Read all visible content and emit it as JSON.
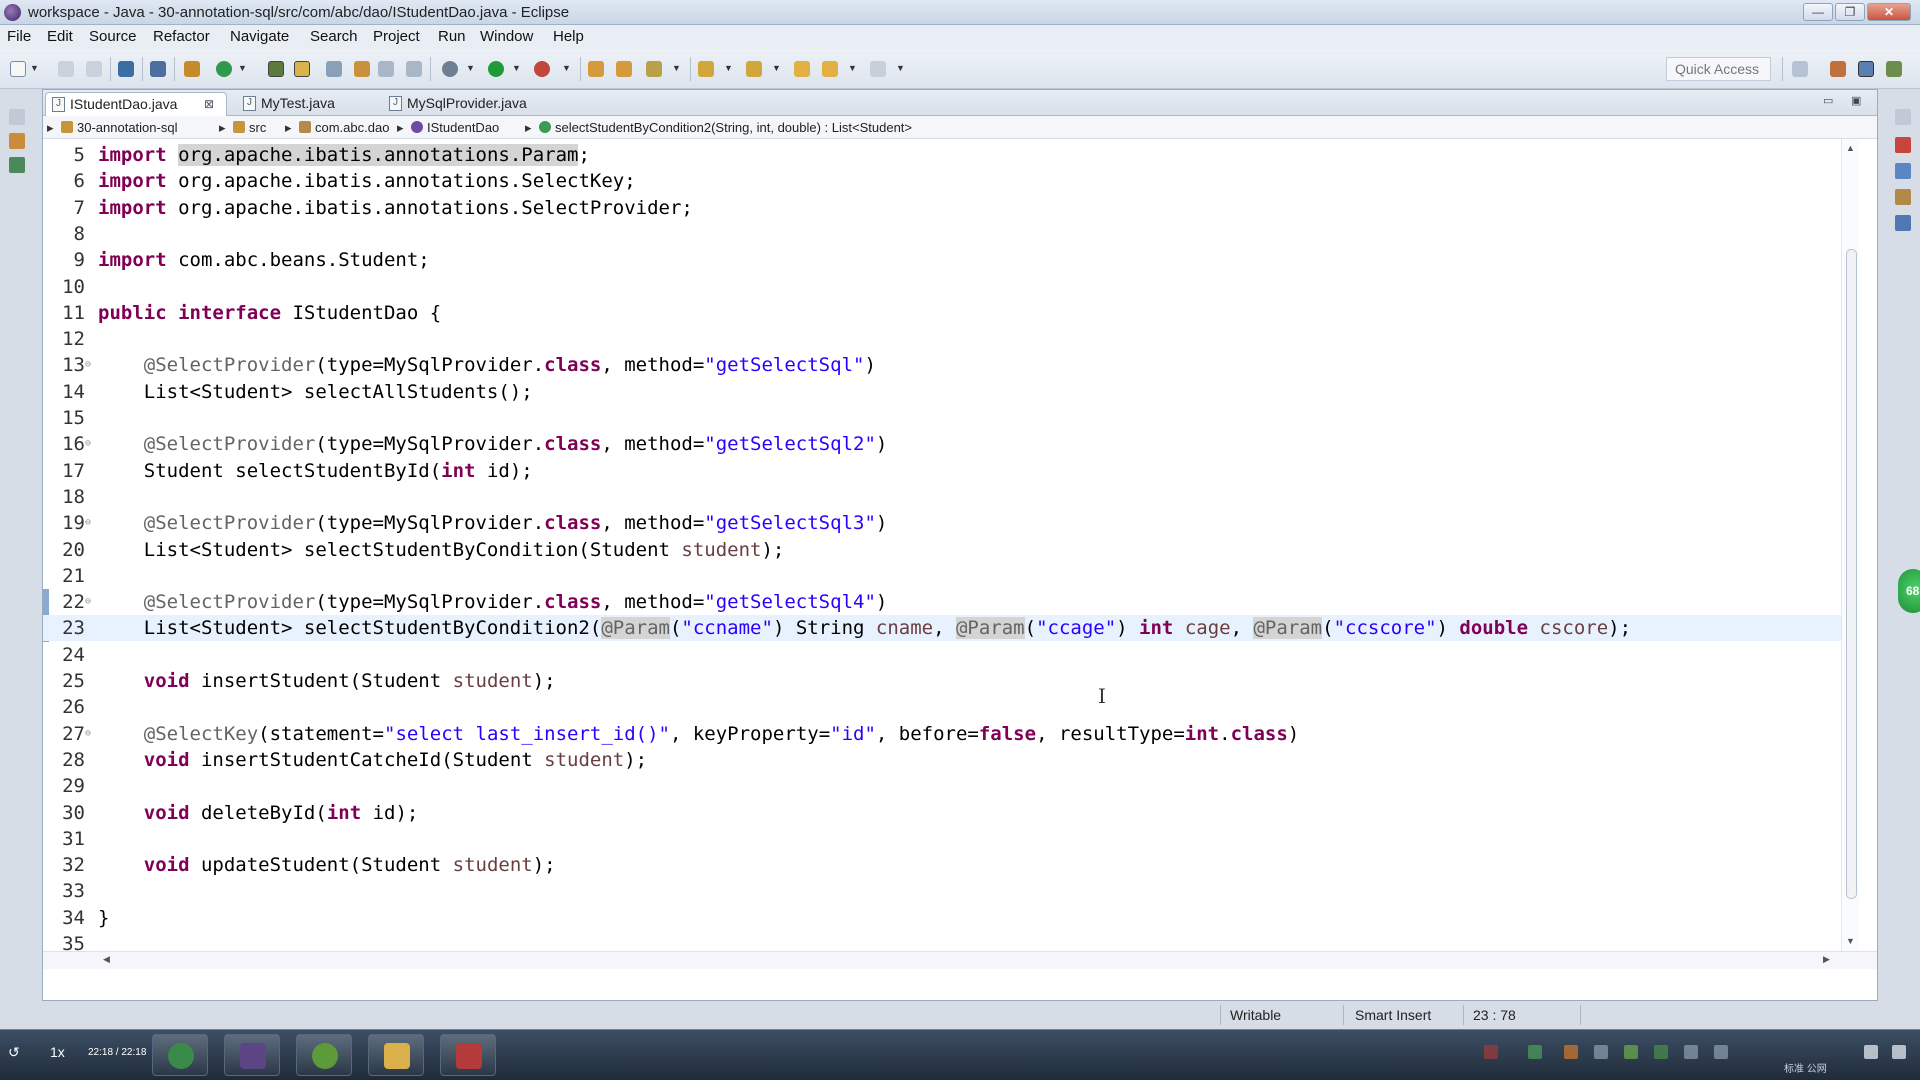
{
  "window": {
    "title": "workspace - Java - 30-annotation-sql/src/com/abc/dao/IStudentDao.java - Eclipse",
    "minimize_symbol": "—",
    "maximize_symbol": "❐",
    "close_symbol": "✕"
  },
  "menu": [
    "File",
    "Edit",
    "Source",
    "Refactor",
    "Navigate",
    "Search",
    "Project",
    "Run",
    "Window",
    "Help"
  ],
  "toolbar": {
    "quick_access_placeholder": "Quick Access"
  },
  "tabs": [
    {
      "label": "IStudentDao.java",
      "active": true,
      "close": "⊠"
    },
    {
      "label": "MyTest.java",
      "active": false
    },
    {
      "label": "MySqlProvider.java",
      "active": false
    }
  ],
  "tab_controls": {
    "minimize": "▭",
    "maximize": "▣"
  },
  "breadcrumb": [
    "30-annotation-sql",
    "src",
    "com.abc.dao",
    "IStudentDao",
    "selectStudentByCondition2(String, int, double) : List<Student>"
  ],
  "code": {
    "current_line": 23,
    "lines": [
      {
        "n": "5",
        "parts": [
          [
            "kw",
            "import"
          ],
          [
            "",
            " "
          ],
          [
            "hl",
            "org.apache.ibatis.annotations.Param"
          ],
          [
            "",
            ";"
          ]
        ]
      },
      {
        "n": "6",
        "parts": [
          [
            "kw",
            "import"
          ],
          [
            "",
            " org.apache.ibatis.annotations.SelectKey;"
          ]
        ]
      },
      {
        "n": "7",
        "parts": [
          [
            "kw",
            "import"
          ],
          [
            "",
            " org.apache.ibatis.annotations.SelectProvider;"
          ]
        ]
      },
      {
        "n": "8",
        "parts": []
      },
      {
        "n": "9",
        "parts": [
          [
            "kw",
            "import"
          ],
          [
            "",
            " com.abc.beans.Student;"
          ]
        ]
      },
      {
        "n": "10",
        "parts": []
      },
      {
        "n": "11",
        "parts": [
          [
            "kw",
            "public"
          ],
          [
            "",
            " "
          ],
          [
            "kw",
            "interface"
          ],
          [
            "",
            " IStudentDao {"
          ]
        ]
      },
      {
        "n": "12",
        "parts": []
      },
      {
        "n": "13",
        "fold": "⊖",
        "parts": [
          [
            "",
            "    "
          ],
          [
            "ann",
            "@SelectProvider"
          ],
          [
            "",
            "(type=MySqlProvider."
          ],
          [
            "kw",
            "class"
          ],
          [
            "",
            ", method="
          ],
          [
            "str",
            "\"getSelectSql\""
          ],
          [
            "",
            ")"
          ]
        ]
      },
      {
        "n": "14",
        "parts": [
          [
            "",
            "    List<Student> selectAllStudents();"
          ]
        ]
      },
      {
        "n": "15",
        "parts": []
      },
      {
        "n": "16",
        "fold": "⊖",
        "parts": [
          [
            "",
            "    "
          ],
          [
            "ann",
            "@SelectProvider"
          ],
          [
            "",
            "(type=MySqlProvider."
          ],
          [
            "kw",
            "class"
          ],
          [
            "",
            ", method="
          ],
          [
            "str",
            "\"getSelectSql2\""
          ],
          [
            "",
            ")"
          ]
        ]
      },
      {
        "n": "17",
        "parts": [
          [
            "",
            "    Student selectStudentById("
          ],
          [
            "kw",
            "int"
          ],
          [
            "",
            " id);"
          ]
        ]
      },
      {
        "n": "18",
        "parts": []
      },
      {
        "n": "19",
        "fold": "⊖",
        "parts": [
          [
            "",
            "    "
          ],
          [
            "ann",
            "@SelectProvider"
          ],
          [
            "",
            "(type=MySqlProvider."
          ],
          [
            "kw",
            "class"
          ],
          [
            "",
            ", method="
          ],
          [
            "str",
            "\"getSelectSql3\""
          ],
          [
            "",
            ")"
          ]
        ]
      },
      {
        "n": "20",
        "parts": [
          [
            "",
            "    List<Student> selectStudentByCondition(Student "
          ],
          [
            "param",
            "student"
          ],
          [
            "",
            ");"
          ]
        ]
      },
      {
        "n": "21",
        "parts": []
      },
      {
        "n": "22",
        "fold": "⊖",
        "parts": [
          [
            "",
            "    "
          ],
          [
            "ann",
            "@SelectProvider"
          ],
          [
            "",
            "(type=MySqlProvider."
          ],
          [
            "kw",
            "class"
          ],
          [
            "",
            ", method="
          ],
          [
            "str",
            "\"getSelectSql4\""
          ],
          [
            "",
            ")"
          ]
        ]
      },
      {
        "n": "23",
        "parts": [
          [
            "",
            "    List<Student> selectStudentByCondition2("
          ],
          [
            "ann hl",
            "@Param"
          ],
          [
            "",
            "("
          ],
          [
            "str",
            "\"ccname\""
          ],
          [
            "",
            ") String "
          ],
          [
            "param",
            "cname"
          ],
          [
            "",
            ", "
          ],
          [
            "ann hl",
            "@Param"
          ],
          [
            "",
            "("
          ],
          [
            "str",
            "\"ccage\""
          ],
          [
            "",
            ") "
          ],
          [
            "kw",
            "int"
          ],
          [
            "",
            " "
          ],
          [
            "param",
            "cage"
          ],
          [
            "",
            ", "
          ],
          [
            "ann hl",
            "@Param"
          ],
          [
            "",
            "("
          ],
          [
            "str",
            "\"ccscore\""
          ],
          [
            "",
            ") "
          ],
          [
            "kw",
            "double"
          ],
          [
            "",
            " "
          ],
          [
            "param",
            "cscore"
          ],
          [
            "",
            ");"
          ]
        ]
      },
      {
        "n": "24",
        "parts": []
      },
      {
        "n": "25",
        "parts": [
          [
            "",
            "    "
          ],
          [
            "kw",
            "void"
          ],
          [
            "",
            " insertStudent(Student "
          ],
          [
            "param",
            "student"
          ],
          [
            "",
            ");"
          ]
        ]
      },
      {
        "n": "26",
        "parts": []
      },
      {
        "n": "27",
        "fold": "⊖",
        "parts": [
          [
            "",
            "    "
          ],
          [
            "ann",
            "@SelectKey"
          ],
          [
            "",
            "(statement="
          ],
          [
            "str",
            "\"select last_insert_id()\""
          ],
          [
            "",
            ", keyProperty="
          ],
          [
            "str",
            "\"id\""
          ],
          [
            "",
            ", before="
          ],
          [
            "kw",
            "false"
          ],
          [
            "",
            ", resultType="
          ],
          [
            "kw",
            "int"
          ],
          [
            "",
            "."
          ],
          [
            "kw",
            "class"
          ],
          [
            "",
            ")"
          ]
        ]
      },
      {
        "n": "28",
        "parts": [
          [
            "",
            "    "
          ],
          [
            "kw",
            "void"
          ],
          [
            "",
            " insertStudentCatcheId(Student "
          ],
          [
            "param",
            "student"
          ],
          [
            "",
            ");"
          ]
        ]
      },
      {
        "n": "29",
        "parts": []
      },
      {
        "n": "30",
        "parts": [
          [
            "",
            "    "
          ],
          [
            "kw",
            "void"
          ],
          [
            "",
            " deleteById("
          ],
          [
            "kw",
            "int"
          ],
          [
            "",
            " id);"
          ]
        ]
      },
      {
        "n": "31",
        "parts": []
      },
      {
        "n": "32",
        "parts": [
          [
            "",
            "    "
          ],
          [
            "kw",
            "void"
          ],
          [
            "",
            " updateStudent(Student "
          ],
          [
            "param",
            "student"
          ],
          [
            "",
            ");"
          ]
        ]
      },
      {
        "n": "33",
        "parts": []
      },
      {
        "n": "34",
        "parts": [
          [
            "",
            "}"
          ]
        ]
      },
      {
        "n": "35",
        "parts": []
      }
    ]
  },
  "status": {
    "writable": "Writable",
    "insert_mode": "Smart Insert",
    "position": "23 : 78"
  },
  "taskbar": {
    "speed": "1x",
    "time": "22:18 / 22:18",
    "tray_text": "标准  公网"
  },
  "floater_label": "68",
  "colors": {
    "keyword": "#7f0055",
    "string": "#2a00ff",
    "annotation": "#646464",
    "current_line": "#e8f2fe"
  }
}
